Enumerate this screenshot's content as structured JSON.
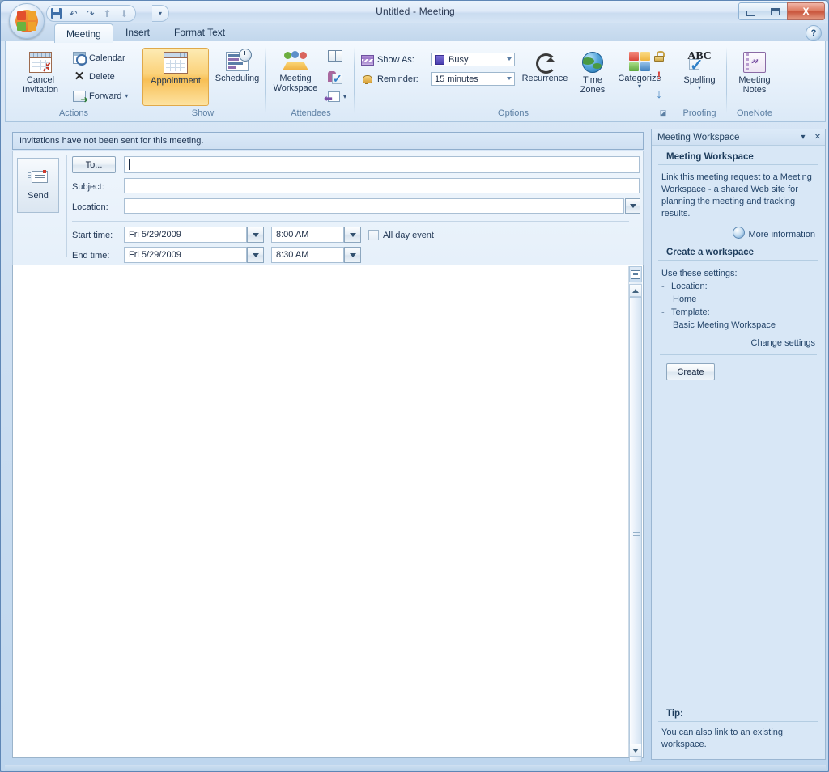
{
  "window": {
    "title": "Untitled - Meeting",
    "minimize_label": "Minimize",
    "maximize_label": "Maximize",
    "close_label": "X"
  },
  "quick_access": {
    "save": "Save",
    "undo": "↶",
    "redo": "↷",
    "up": "⬆",
    "down": "⬇",
    "customize": "▾"
  },
  "help": {
    "label": "?"
  },
  "tabs": [
    {
      "label": "Meeting",
      "active": true
    },
    {
      "label": "Insert",
      "active": false
    },
    {
      "label": "Format Text",
      "active": false
    }
  ],
  "ribbon": {
    "groups": [
      {
        "name": "Actions",
        "label": "Actions",
        "buttons": {
          "cancel_invitation": "Cancel\nInvitation",
          "cancel_invitation_line1": "Cancel",
          "cancel_invitation_line2": "Invitation",
          "calendar": "Calendar",
          "delete": "Delete",
          "forward": "Forward",
          "forward_caret": "▾"
        }
      },
      {
        "name": "Show",
        "label": "Show",
        "buttons": {
          "appointment": "Appointment",
          "scheduling": "Scheduling"
        }
      },
      {
        "name": "Attendees",
        "label": "Attendees",
        "buttons": {
          "meeting_workspace_line1": "Meeting",
          "meeting_workspace_line2": "Workspace",
          "address_book": "Address Book",
          "check_names": "Check Names",
          "response_options": "Response Options",
          "response_options_caret": "▾"
        }
      },
      {
        "name": "Options",
        "label": "Options",
        "fields": {
          "show_as_label": "Show As:",
          "show_as_value": "Busy",
          "reminder_label": "Reminder:",
          "reminder_value": "15 minutes"
        },
        "buttons": {
          "recurrence": "Recurrence",
          "time_zones_line1": "Time",
          "time_zones_line2": "Zones",
          "categorize": "Categorize",
          "categorize_caret": "▾",
          "private": "Private",
          "high_importance": "!",
          "low_importance": "↓"
        },
        "dialog_launcher": "◪"
      },
      {
        "name": "Proofing",
        "label": "Proofing",
        "buttons": {
          "spelling": "Spelling",
          "spelling_caret": "▾",
          "spelling_glyph": "ABC"
        }
      },
      {
        "name": "OneNote",
        "label": "OneNote",
        "buttons": {
          "meeting_notes_line1": "Meeting",
          "meeting_notes_line2": "Notes"
        }
      }
    ]
  },
  "infobar": {
    "message": "Invitations have not been sent for this meeting."
  },
  "form": {
    "send_label": "Send",
    "to_button": "To...",
    "to_value": "",
    "subject_label": "Subject:",
    "subject_value": "",
    "location_label": "Location:",
    "location_value": "",
    "start_time_label": "Start time:",
    "start_date_value": "Fri 5/29/2009",
    "start_clock_value": "8:00 AM",
    "end_time_label": "End time:",
    "end_date_value": "Fri 5/29/2009",
    "end_clock_value": "8:30 AM",
    "all_day_label": "All day event",
    "all_day_checked": false,
    "body_value": ""
  },
  "task_pane": {
    "header_title": "Meeting Workspace",
    "menu_caret": "▾",
    "close_glyph": "✕",
    "section1_title": "Meeting Workspace",
    "section1_text": "Link this meeting request to a Meeting Workspace - a shared Web site for planning the meeting and tracking results.",
    "more_information": "More information",
    "section2_title": "Create a workspace",
    "use_settings": "Use these settings:",
    "location_label": "Location:",
    "location_value": "Home",
    "template_label": "Template:",
    "template_value": "Basic Meeting Workspace",
    "change_settings": "Change settings",
    "create_button": "Create",
    "tip_title": "Tip:",
    "tip_text": "You can also link to an existing workspace."
  },
  "colors": {
    "accent": "#f8bf55",
    "chrome": "#cfe0f2",
    "text": "#1f3553",
    "taskpane_bg": "#d8e7f6",
    "close_button": "#c9553c"
  }
}
